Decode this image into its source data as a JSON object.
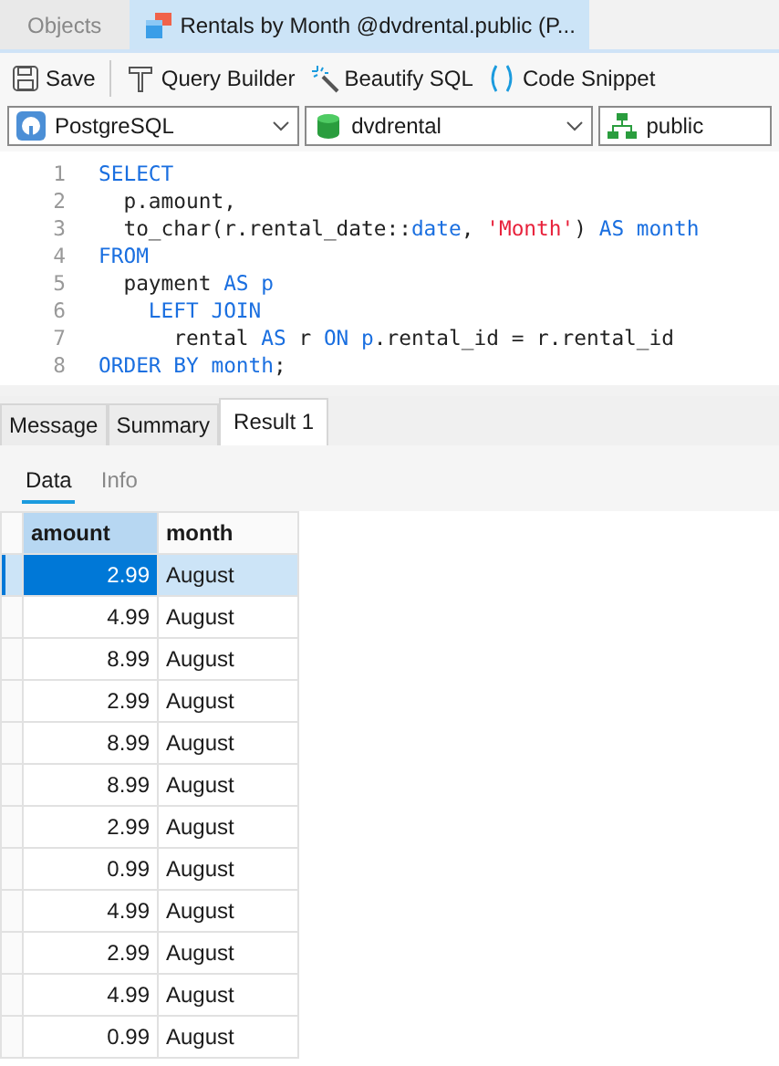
{
  "tabs": [
    {
      "label": "Objects",
      "selected": false
    },
    {
      "label": "Rentals by Month @dvdrental.public (P...",
      "selected": true
    }
  ],
  "toolbar": [
    "Save",
    "Query Builder",
    "Beautify SQL",
    "Code Snippet"
  ],
  "selectors": [
    {
      "kind": "connection",
      "value": "PostgreSQL",
      "dropdown": true
    },
    {
      "kind": "database",
      "value": "dvdrental",
      "dropdown": true
    },
    {
      "kind": "schema",
      "value": "public",
      "dropdown": false
    }
  ],
  "editor": {
    "lines": [
      {
        "number": "1",
        "tokens": [
          {
            "kind": "keyword",
            "text": "SELECT"
          }
        ]
      },
      {
        "number": "2",
        "tokens": [
          {
            "kind": "plain",
            "text": "  p.amount,"
          }
        ]
      },
      {
        "number": "3",
        "tokens": [
          {
            "kind": "plain",
            "text": "  to_char(r.rental_date::"
          },
          {
            "kind": "keyword",
            "text": "date"
          },
          {
            "kind": "plain",
            "text": ", "
          },
          {
            "kind": "string",
            "text": "'Month'"
          },
          {
            "kind": "plain",
            "text": ") "
          },
          {
            "kind": "keyword",
            "text": "AS month"
          }
        ]
      },
      {
        "number": "4",
        "tokens": [
          {
            "kind": "keyword",
            "text": "FROM"
          }
        ]
      },
      {
        "number": "5",
        "tokens": [
          {
            "kind": "plain",
            "text": "  payment "
          },
          {
            "kind": "keyword",
            "text": "AS p"
          }
        ]
      },
      {
        "number": "6",
        "tokens": [
          {
            "kind": "keyword",
            "text": "    LEFT JOIN"
          }
        ]
      },
      {
        "number": "7",
        "tokens": [
          {
            "kind": "plain",
            "text": "      rental "
          },
          {
            "kind": "keyword",
            "text": "AS"
          },
          {
            "kind": "plain",
            "text": " r "
          },
          {
            "kind": "keyword",
            "text": "ON p"
          },
          {
            "kind": "plain",
            "text": ".rental_id = r.rental_id"
          }
        ]
      },
      {
        "number": "8",
        "tokens": [
          {
            "kind": "keyword",
            "text": "ORDER BY month"
          },
          {
            "kind": "plain",
            "text": ";"
          }
        ]
      }
    ]
  },
  "result_tabs": [
    {
      "label": "Message",
      "selected": false
    },
    {
      "label": "Summary",
      "selected": false
    },
    {
      "label": "Result 1",
      "selected": true
    }
  ],
  "view_tabs": [
    {
      "label": "Data",
      "selected": true
    },
    {
      "label": "Info",
      "selected": false
    }
  ],
  "table": {
    "columns": [
      "amount",
      "month"
    ],
    "rows": [
      {
        "cells": [
          "2.99",
          "August"
        ],
        "selected": true
      },
      {
        "cells": [
          "4.99",
          "August"
        ],
        "selected": false
      },
      {
        "cells": [
          "8.99",
          "August"
        ],
        "selected": false
      },
      {
        "cells": [
          "2.99",
          "August"
        ],
        "selected": false
      },
      {
        "cells": [
          "8.99",
          "August"
        ],
        "selected": false
      },
      {
        "cells": [
          "8.99",
          "August"
        ],
        "selected": false
      },
      {
        "cells": [
          "2.99",
          "August"
        ],
        "selected": false
      },
      {
        "cells": [
          "0.99",
          "August"
        ],
        "selected": false
      },
      {
        "cells": [
          "4.99",
          "August"
        ],
        "selected": false
      },
      {
        "cells": [
          "2.99",
          "August"
        ],
        "selected": false
      },
      {
        "cells": [
          "4.99",
          "August"
        ],
        "selected": false
      },
      {
        "cells": [
          "0.99",
          "August"
        ],
        "selected": false
      }
    ]
  }
}
